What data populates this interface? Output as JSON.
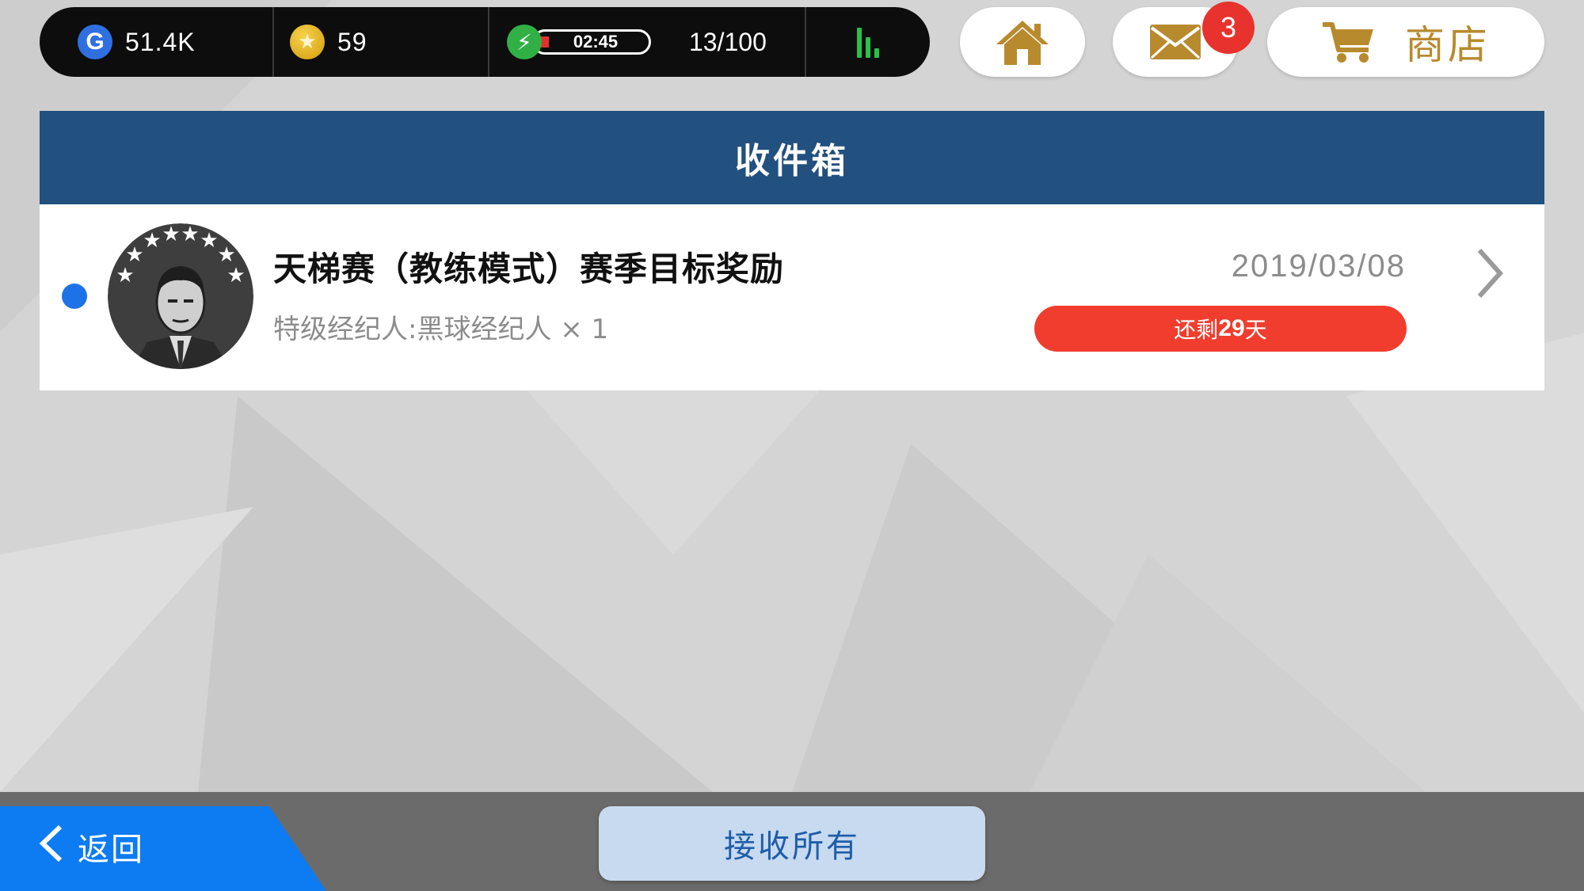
{
  "currency": {
    "gp_icon_letter": "G",
    "gp_value": "51.4K",
    "coin_value": "59"
  },
  "energy": {
    "timer": "02:45",
    "count": "13/100",
    "level_fraction": 0.13
  },
  "nav": {
    "mail_badge": "3",
    "shop_label": "商店"
  },
  "inbox": {
    "title": "收件箱",
    "messages": [
      {
        "title": "天梯赛（教练模式）赛季目标奖励",
        "reward": "特级经纪人:黑球经纪人 × 1",
        "date": "2019/03/08",
        "expiry_prefix": "还剩",
        "expiry_days": "29",
        "expiry_suffix": "天",
        "unread": true
      }
    ]
  },
  "footer": {
    "back_label": "返回",
    "receive_all_label": "接收所有"
  },
  "colors": {
    "header_blue": "#22507f",
    "accent_gold": "#b88a2e",
    "expiry_red": "#f03d2e",
    "unread_blue": "#1d72e8",
    "back_blue": "#0d7bf2"
  }
}
